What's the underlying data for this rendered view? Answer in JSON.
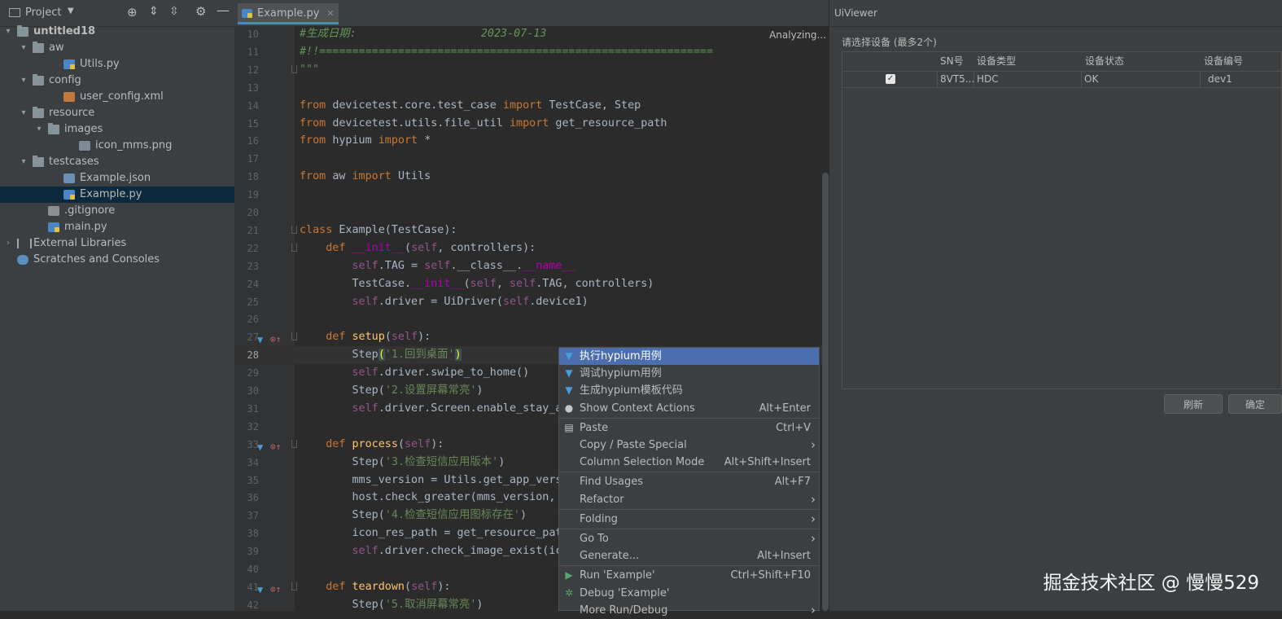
{
  "project": {
    "title": "Project",
    "tree": [
      {
        "label": "untitled18",
        "indent": 0,
        "arrow": "▾",
        "icon": "folder",
        "bold": true
      },
      {
        "label": "aw",
        "indent": 1,
        "arrow": "▾",
        "icon": "folder"
      },
      {
        "label": "Utils.py",
        "indent": 3,
        "icon": "pyfile"
      },
      {
        "label": "config",
        "indent": 1,
        "arrow": "▾",
        "icon": "folder"
      },
      {
        "label": "user_config.xml",
        "indent": 3,
        "icon": "xmlfile"
      },
      {
        "label": "resource",
        "indent": 1,
        "arrow": "▾",
        "icon": "folder"
      },
      {
        "label": "images",
        "indent": 2,
        "arrow": "▾",
        "icon": "folder"
      },
      {
        "label": "icon_mms.png",
        "indent": 4,
        "icon": "pngfile"
      },
      {
        "label": "testcases",
        "indent": 1,
        "arrow": "▾",
        "icon": "folder"
      },
      {
        "label": "Example.json",
        "indent": 3,
        "icon": "jsonfile"
      },
      {
        "label": "Example.py",
        "indent": 3,
        "icon": "pyfile",
        "selected": true
      },
      {
        "label": ".gitignore",
        "indent": 2,
        "icon": "gitfile"
      },
      {
        "label": "main.py",
        "indent": 2,
        "icon": "pyfile"
      },
      {
        "label": "External Libraries",
        "indent": 0,
        "arrow": "›",
        "icon": "libfile"
      },
      {
        "label": "Scratches and Consoles",
        "indent": 0,
        "icon": "scratchfile"
      }
    ]
  },
  "editor": {
    "tab_label": "Example.py",
    "status": "Analyzing...",
    "current_line": 28,
    "lines": [
      {
        "n": 10,
        "t": [
          [
            "cm",
            "#生成日期:                   2023-07-13"
          ]
        ]
      },
      {
        "n": 11,
        "t": [
          [
            "cm",
            "#!!============================================================"
          ]
        ]
      },
      {
        "n": 12,
        "t": [
          [
            "st",
            "\"\"\""
          ]
        ],
        "fold": true
      },
      {
        "n": 13,
        "t": []
      },
      {
        "n": 14,
        "t": [
          [
            "kw",
            "from "
          ],
          [
            "",
            "devicetest.core.test_case "
          ],
          [
            "kw",
            "import "
          ],
          [
            "",
            "TestCase, Step"
          ]
        ]
      },
      {
        "n": 15,
        "t": [
          [
            "kw",
            "from "
          ],
          [
            "",
            "devicetest.utils.file_util "
          ],
          [
            "kw",
            "import "
          ],
          [
            "",
            "get_resource_path"
          ]
        ]
      },
      {
        "n": 16,
        "t": [
          [
            "kw",
            "from "
          ],
          [
            "",
            "hypium "
          ],
          [
            "kw",
            "import "
          ],
          [
            "",
            "*"
          ]
        ]
      },
      {
        "n": 17,
        "t": []
      },
      {
        "n": 18,
        "t": [
          [
            "kw",
            "from "
          ],
          [
            "",
            "aw "
          ],
          [
            "kw",
            "import "
          ],
          [
            "",
            "Utils"
          ]
        ]
      },
      {
        "n": 19,
        "t": []
      },
      {
        "n": 20,
        "t": []
      },
      {
        "n": 21,
        "t": [
          [
            "kw",
            "class "
          ],
          [
            "",
            "Example(TestCase):"
          ]
        ],
        "fold": true
      },
      {
        "n": 22,
        "t": [
          [
            "",
            "    "
          ],
          [
            "kw",
            "def "
          ],
          [
            "dn",
            "__init__"
          ],
          [
            "",
            "("
          ],
          [
            "sf",
            "self"
          ],
          [
            "",
            ", controllers):"
          ]
        ],
        "fold": true
      },
      {
        "n": 23,
        "t": [
          [
            "",
            "        "
          ],
          [
            "sf",
            "self"
          ],
          [
            "",
            ".TAG = "
          ],
          [
            "sf",
            "self"
          ],
          [
            "",
            ".__class__."
          ],
          [
            "dn",
            "__name__"
          ]
        ]
      },
      {
        "n": 24,
        "t": [
          [
            "",
            "        TestCase."
          ],
          [
            "dn",
            "__init__"
          ],
          [
            "",
            "("
          ],
          [
            "sf",
            "self"
          ],
          [
            "",
            ", "
          ],
          [
            "sf",
            "self"
          ],
          [
            "",
            ".TAG, controllers)"
          ]
        ]
      },
      {
        "n": 25,
        "t": [
          [
            "",
            "        "
          ],
          [
            "sf",
            "self"
          ],
          [
            "",
            ".driver = UiDriver("
          ],
          [
            "sf",
            "self"
          ],
          [
            "",
            ".device1)"
          ]
        ]
      },
      {
        "n": 26,
        "t": []
      },
      {
        "n": 27,
        "t": [
          [
            "",
            "    "
          ],
          [
            "kw",
            "def "
          ],
          [
            "fn",
            "setup"
          ],
          [
            "",
            "("
          ],
          [
            "sf",
            "self"
          ],
          [
            "",
            "):"
          ]
        ],
        "marks": true,
        "fold": true
      },
      {
        "n": 28,
        "t": [
          [
            "",
            "        Step"
          ],
          [
            "br",
            "("
          ],
          [
            "st",
            "'1.回到桌面'"
          ],
          [
            "br",
            ")"
          ]
        ]
      },
      {
        "n": 29,
        "t": [
          [
            "",
            "        "
          ],
          [
            "sf",
            "self"
          ],
          [
            "",
            ".driver.swipe_to_home()"
          ]
        ]
      },
      {
        "n": 30,
        "t": [
          [
            "",
            "        Step("
          ],
          [
            "st",
            "'2.设置屏幕常亮'"
          ],
          [
            "",
            ")"
          ]
        ]
      },
      {
        "n": 31,
        "t": [
          [
            "",
            "        "
          ],
          [
            "sf",
            "self"
          ],
          [
            "",
            ".driver.Screen.enable_stay_a"
          ]
        ]
      },
      {
        "n": 32,
        "t": []
      },
      {
        "n": 33,
        "t": [
          [
            "",
            "    "
          ],
          [
            "kw",
            "def "
          ],
          [
            "fn",
            "process"
          ],
          [
            "",
            "("
          ],
          [
            "sf",
            "self"
          ],
          [
            "",
            "):"
          ]
        ],
        "marks": true,
        "fold": true
      },
      {
        "n": 34,
        "t": [
          [
            "",
            "        Step("
          ],
          [
            "st",
            "'3.检查短信应用版本'"
          ],
          [
            "",
            ")"
          ]
        ]
      },
      {
        "n": 35,
        "t": [
          [
            "",
            "        mms_version = Utils.get_app_vers"
          ]
        ]
      },
      {
        "n": 36,
        "t": [
          [
            "",
            "        host.check_greater(mms_version,"
          ]
        ]
      },
      {
        "n": 37,
        "t": [
          [
            "",
            "        Step("
          ],
          [
            "st",
            "'4.检查短信应用图标存在'"
          ],
          [
            "",
            ")"
          ]
        ]
      },
      {
        "n": 38,
        "t": [
          [
            "",
            "        icon_res_path = get_resource_pat"
          ]
        ]
      },
      {
        "n": 39,
        "t": [
          [
            "",
            "        "
          ],
          [
            "sf",
            "self"
          ],
          [
            "",
            ".driver.check_image_exist(ic"
          ]
        ]
      },
      {
        "n": 40,
        "t": []
      },
      {
        "n": 41,
        "t": [
          [
            "",
            "    "
          ],
          [
            "kw",
            "def "
          ],
          [
            "fn",
            "teardown"
          ],
          [
            "",
            "("
          ],
          [
            "sf",
            "self"
          ],
          [
            "",
            "):"
          ]
        ],
        "marks": true,
        "fold": true
      },
      {
        "n": 42,
        "t": [
          [
            "",
            "        Step("
          ],
          [
            "st",
            "'5.取消屏幕常亮'"
          ],
          [
            "",
            ")"
          ]
        ]
      }
    ]
  },
  "context_menu": {
    "items": [
      {
        "label": "执行hypium用例",
        "icon": "hypium-icon",
        "selected": true
      },
      {
        "label": "调试hypium用例",
        "icon": "hypium-icon"
      },
      {
        "label": "生成hypium模板代码",
        "icon": "hypium-icon"
      },
      {
        "label": "Show Context Actions",
        "shortcut": "Alt+Enter",
        "icon": "bulb-icon"
      },
      {
        "sep": true
      },
      {
        "label": "Paste",
        "shortcut": "Ctrl+V",
        "icon": "clipboard-icon"
      },
      {
        "label": "Copy / Paste Special",
        "submenu": true
      },
      {
        "label": "Column Selection Mode",
        "shortcut": "Alt+Shift+Insert"
      },
      {
        "sep": true
      },
      {
        "label": "Find Usages",
        "shortcut": "Alt+F7"
      },
      {
        "label": "Refactor",
        "submenu": true
      },
      {
        "sep": true
      },
      {
        "label": "Folding",
        "submenu": true
      },
      {
        "sep": true
      },
      {
        "label": "Go To",
        "submenu": true
      },
      {
        "label": "Generate...",
        "shortcut": "Alt+Insert"
      },
      {
        "sep": true
      },
      {
        "label": "Run 'Example'",
        "shortcut": "Ctrl+Shift+F10",
        "icon": "run-icon"
      },
      {
        "label": "Debug 'Example'",
        "icon": "debug-icon"
      },
      {
        "label": "More Run/Debug",
        "submenu": true
      }
    ]
  },
  "uiviewer": {
    "title": "UiViewer",
    "label": "请选择设备 (最多2个)",
    "columns": [
      "SN号",
      "设备类型",
      "设备状态",
      "设备编号"
    ],
    "rows": [
      {
        "checked": true,
        "sn": "8VT5...",
        "type": "HDC",
        "status": "OK",
        "id": "dev1"
      }
    ],
    "refresh_button": "刷新",
    "confirm_button": "确定"
  },
  "watermark": "掘金技术社区 @ 慢慢529",
  "colors": {
    "accent": "#4a88c7",
    "menu_selected": "#4b6eaf",
    "keyword": "#cc7832",
    "string": "#6a8759",
    "comment": "#629755"
  }
}
